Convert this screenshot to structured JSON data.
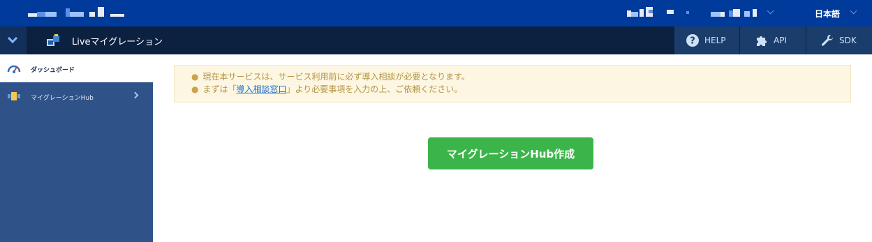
{
  "topbar": {
    "language_label": "日本語"
  },
  "appbar": {
    "app_title": "Liveマイグレーション",
    "help_label": "HELP",
    "api_label": "API",
    "sdk_label": "SDK"
  },
  "sidebar": {
    "items": [
      {
        "label": "ダッシュボード",
        "icon": "gauge-icon",
        "active": true
      },
      {
        "label": "マイグレーションHub",
        "icon": "migration-hub-icon",
        "active": false
      }
    ]
  },
  "notice": {
    "line1": "現在本サービスは、サービス利用前に必ず導入相談が必要となります。",
    "line2_prefix": "まずは「",
    "line2_link": "導入相談窓口",
    "line2_suffix": "」より必要事項を入力の上、ご依頼ください。"
  },
  "main": {
    "create_button_label": "マイグレーションHub作成"
  },
  "colors": {
    "topbar": "#003a9a",
    "appbar": "#0c2140",
    "sidebar": "#2f5289",
    "create_button": "#3bb54a",
    "notice_bg": "#fdf6e3",
    "notice_text": "#b5943f"
  }
}
